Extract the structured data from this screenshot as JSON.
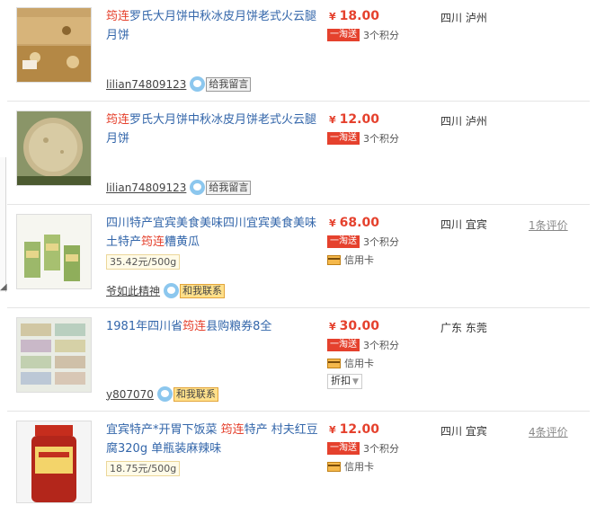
{
  "items": [
    {
      "hl": "筠连",
      "title_rest": "罗氏大月饼中秋冰皮月饼老式火云腿月饼",
      "price": "18.00",
      "yen": "¥",
      "promo": "一淘送",
      "points": "3个积分",
      "location": "四川 泸州",
      "seller": "lilian74809123",
      "contact_label": "给我留言"
    },
    {
      "hl": "筠连",
      "title_rest": "罗氏大月饼中秋冰皮月饼老式火云腿月饼",
      "price": "12.00",
      "yen": "¥",
      "promo": "一淘送",
      "points": "3个积分",
      "location": "四川 泸州",
      "seller": "lilian74809123",
      "contact_label": "给我留言"
    },
    {
      "title_pre": "四川特产宜宾美食美味四川宜宾美食美味土特产",
      "hl": "筠连",
      "title_post": "糟黄瓜",
      "unit_price": "35.42元/500g",
      "price": "68.00",
      "yen": "¥",
      "promo": "一淘送",
      "points": "3个积分",
      "credit": "信用卡",
      "location": "四川 宜宾",
      "reviews": "1条评价",
      "seller": "爷如此精神",
      "contact_label": "和我联系"
    },
    {
      "title_pre": "1981年四川省",
      "hl": "筠连",
      "title_post": "县购粮券8全",
      "price": "30.00",
      "yen": "¥",
      "promo": "一淘送",
      "points": "3个积分",
      "credit": "信用卡",
      "discount": "折扣",
      "location": "广东 东莞",
      "seller": "y807070",
      "contact_label": "和我联系"
    },
    {
      "title_pre": "宜宾特产*开胃下饭菜 ",
      "hl": "筠连",
      "title_post": "特产 村夫红豆腐320g 单瓶装麻辣味",
      "unit_price": "18.75元/500g",
      "price": "12.00",
      "yen": "¥",
      "promo": "一淘送",
      "points": "3个积分",
      "credit": "信用卡",
      "location": "四川 宜宾",
      "reviews": "4条评价"
    }
  ]
}
